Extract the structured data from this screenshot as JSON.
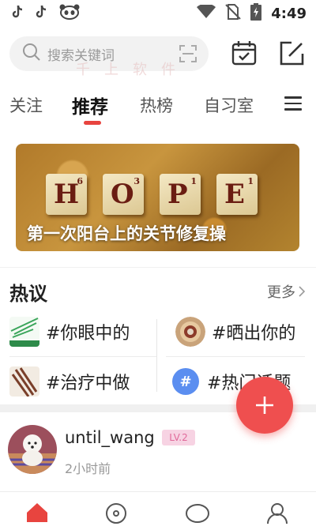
{
  "status_bar": {
    "left_icons": [
      "tiktok-icon",
      "tiktok-icon",
      "panda-icon"
    ],
    "right_icons": [
      "wifi-icon",
      "no-sim-icon",
      "battery-charging-icon"
    ],
    "time": "4:49"
  },
  "header": {
    "search_placeholder": "搜索关键词",
    "watermark": "千上软件"
  },
  "tabs": [
    {
      "label": "关注"
    },
    {
      "label": "推荐"
    },
    {
      "label": "热榜"
    },
    {
      "label": "自习室"
    }
  ],
  "banner": {
    "tiles": [
      {
        "letter": "H",
        "number": "6"
      },
      {
        "letter": "O",
        "number": "3"
      },
      {
        "letter": "P",
        "number": "1"
      },
      {
        "letter": "E",
        "number": "1"
      }
    ],
    "caption": "第一次阳台上的关节修复操"
  },
  "hot_topics": {
    "title": "热议",
    "more_label": "更多",
    "items": [
      {
        "text": "#你眼中的",
        "icon": "sport-lines-thumb"
      },
      {
        "text": "#晒出你的",
        "icon": "pizza-thumb"
      },
      {
        "text": "#治疗中做",
        "icon": "sticks-thumb"
      },
      {
        "text": "#热门话题",
        "icon": "hash-icon"
      }
    ]
  },
  "post": {
    "username": "until_wang",
    "level": "LV.2",
    "time": "2小时前"
  },
  "colors": {
    "accent": "#e8443f",
    "fab": "#ef4f4f",
    "level_bg": "#f7d3e3",
    "level_text": "#e06a9a"
  }
}
